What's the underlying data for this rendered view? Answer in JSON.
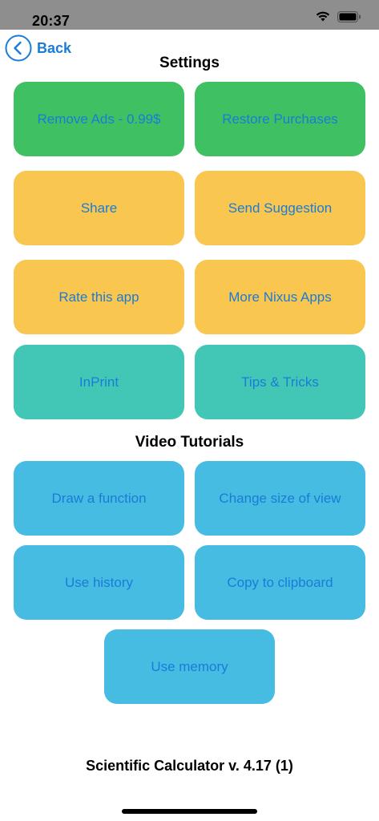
{
  "status_bar": {
    "time": "20:37"
  },
  "nav": {
    "back_label": "Back"
  },
  "settings": {
    "title": "Settings",
    "buttons": [
      {
        "label": "Remove Ads - 0.99$",
        "color": "#3fc163"
      },
      {
        "label": "Restore Purchases",
        "color": "#3fc163"
      },
      {
        "label": "Share",
        "color": "#f9c64f"
      },
      {
        "label": "Send Suggestion",
        "color": "#f9c64f"
      },
      {
        "label": "Rate this app",
        "color": "#f9c64f"
      },
      {
        "label": "More Nixus Apps",
        "color": "#f9c64f"
      },
      {
        "label": "InPrint",
        "color": "#42c7b7"
      },
      {
        "label": "Tips & Tricks",
        "color": "#42c7b7"
      }
    ]
  },
  "tutorials": {
    "title": "Video Tutorials",
    "buttons": [
      {
        "label": "Draw a function",
        "color": "#46bce3"
      },
      {
        "label": "Change size of view",
        "color": "#46bce3"
      },
      {
        "label": "Use history",
        "color": "#46bce3"
      },
      {
        "label": "Copy to clipboard",
        "color": "#46bce3"
      },
      {
        "label": "Use memory",
        "color": "#46bce3"
      }
    ]
  },
  "footer": {
    "version": "Scientific Calculator v. 4.17 (1)"
  },
  "theme": {
    "accent": "#1a7cd6"
  }
}
